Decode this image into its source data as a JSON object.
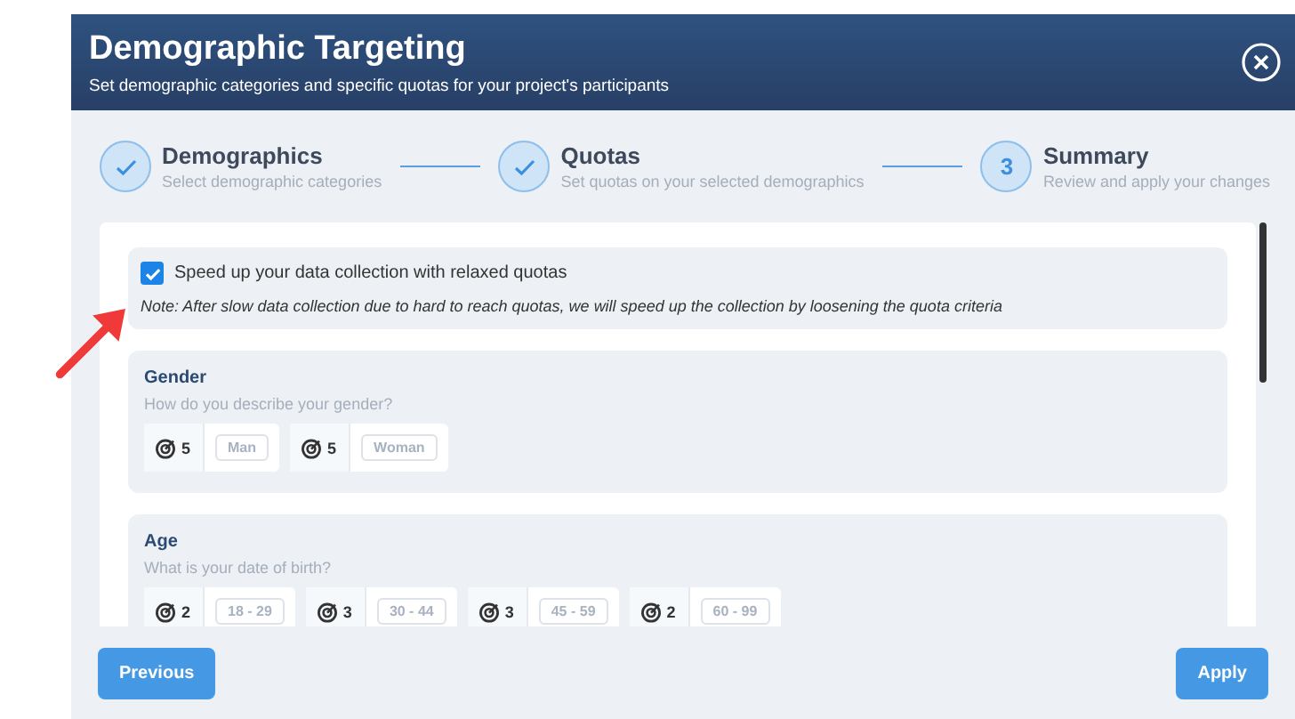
{
  "dialog": {
    "title": "Demographic Targeting",
    "subtitle": "Set demographic categories and specific quotas for your project's participants"
  },
  "steps": [
    {
      "title": "Demographics",
      "subtitle": "Select demographic categories",
      "done": true
    },
    {
      "title": "Quotas",
      "subtitle": "Set quotas on your selected demographics",
      "done": true
    },
    {
      "title": "Summary",
      "subtitle": "Review and apply your changes",
      "done": false,
      "number": "3"
    }
  ],
  "relaxed": {
    "label": "Speed up your data collection with relaxed quotas",
    "checked": true,
    "note": "Note: After slow data collection due to hard to reach quotas, we will speed up the collection by loosening the quota criteria"
  },
  "categories": [
    {
      "name": "Gender",
      "question": "How do you describe your gender?",
      "quotas": [
        {
          "count": "5",
          "option": "Man"
        },
        {
          "count": "5",
          "option": "Woman"
        }
      ]
    },
    {
      "name": "Age",
      "question": "What is your date of birth?",
      "quotas": [
        {
          "count": "2",
          "option": "18 - 29"
        },
        {
          "count": "3",
          "option": "30 - 44"
        },
        {
          "count": "3",
          "option": "45 - 59"
        },
        {
          "count": "2",
          "option": "60 - 99"
        }
      ]
    }
  ],
  "buttons": {
    "previous": "Previous",
    "apply": "Apply"
  }
}
